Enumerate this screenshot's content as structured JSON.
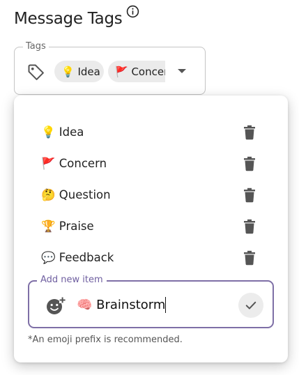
{
  "page": {
    "title": "Message Tags"
  },
  "tags_field": {
    "legend": "Tags",
    "selected": [
      {
        "emoji": "💡",
        "label": "Idea",
        "display": "💡 Idea"
      },
      {
        "emoji": "🚩",
        "label": "Concer",
        "display": "🚩 Concer"
      }
    ]
  },
  "options": [
    {
      "label": "💡 Idea"
    },
    {
      "label": "🚩 Concern"
    },
    {
      "label": "🤔 Question"
    },
    {
      "label": "🏆 Praise"
    },
    {
      "label": "💬 Feedback"
    }
  ],
  "add_item": {
    "legend": "Add new item",
    "value": "🧠 Brainstorm",
    "hint": "*An emoji prefix is recommended."
  },
  "colors": {
    "accent": "#7e6fa6",
    "icon_gray": "#6b6b6b",
    "chip_bg": "#ebebeb"
  },
  "icons": [
    "info-icon",
    "tag-icon",
    "chevron-down-icon",
    "trash-icon",
    "add-emoji-icon",
    "check-icon"
  ]
}
